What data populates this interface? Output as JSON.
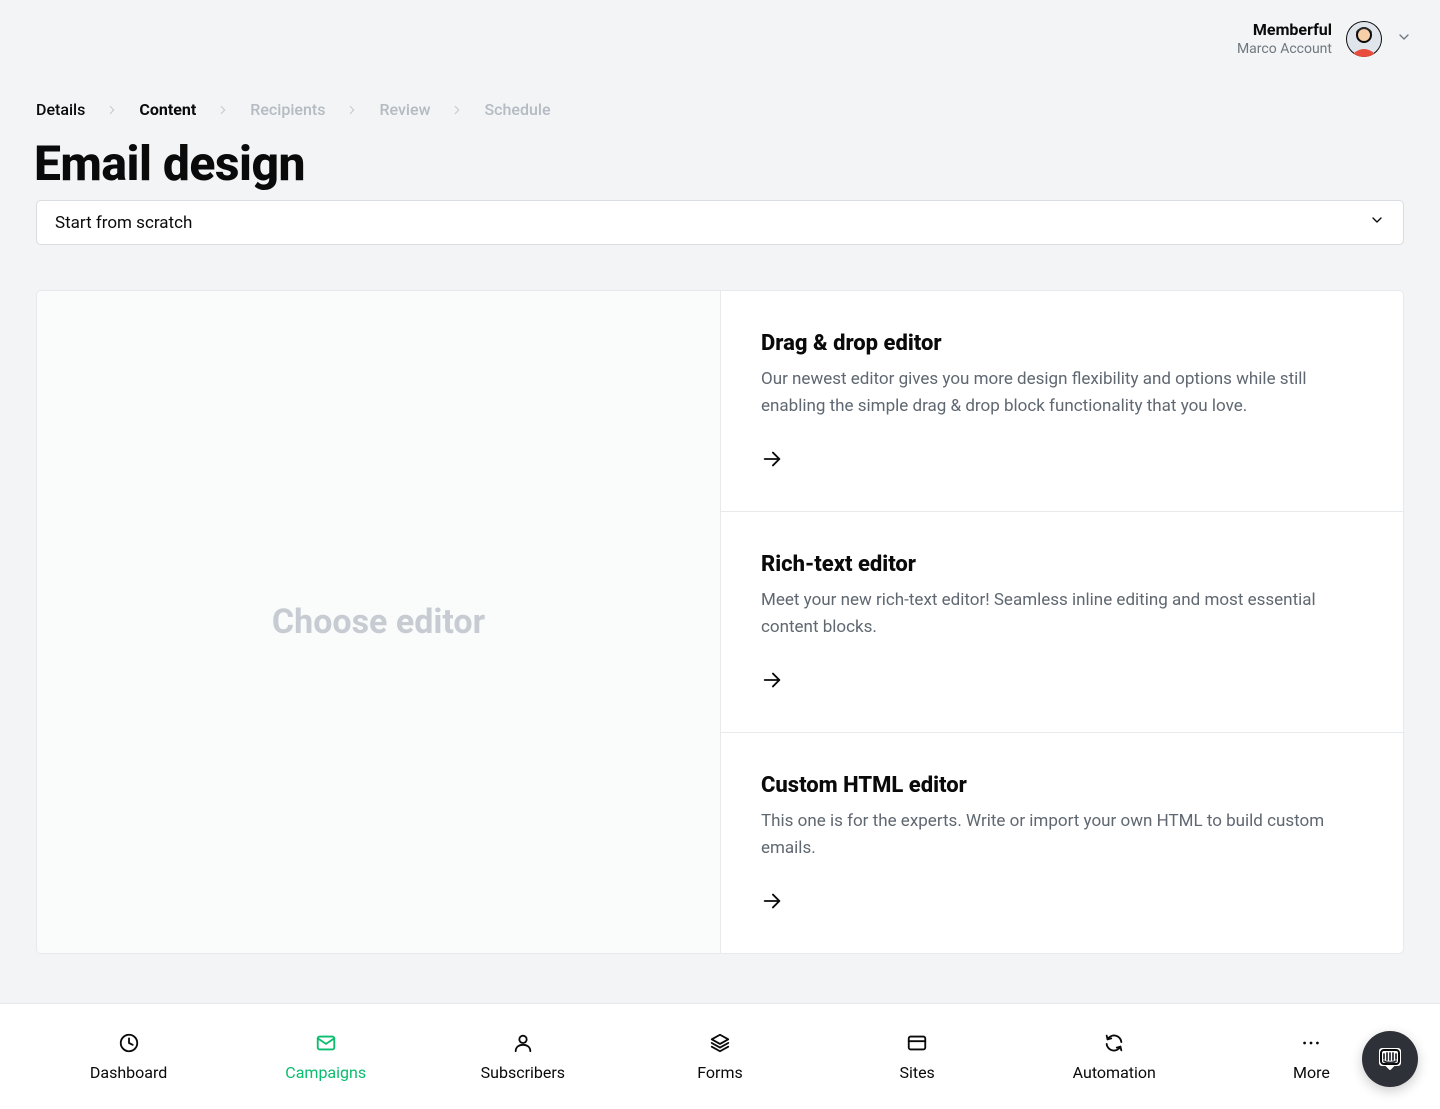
{
  "header": {
    "account_name": "Memberful",
    "account_sub": "Marco Account"
  },
  "breadcrumb": {
    "items": [
      {
        "label": "Details",
        "state": "done"
      },
      {
        "label": "Content",
        "state": "active"
      },
      {
        "label": "Recipients",
        "state": "disabled"
      },
      {
        "label": "Review",
        "state": "disabled"
      },
      {
        "label": "Schedule",
        "state": "disabled"
      }
    ]
  },
  "page": {
    "title": "Email design"
  },
  "template_select": {
    "value": "Start from scratch"
  },
  "preview": {
    "placeholder": "Choose editor"
  },
  "editors": [
    {
      "title": "Drag & drop editor",
      "desc": "Our newest editor gives you more design flexibility and options while still enabling the simple drag & drop block functionality that you love."
    },
    {
      "title": "Rich-text editor",
      "desc": "Meet your new rich-text editor! Seamless inline editing and most essential content blocks."
    },
    {
      "title": "Custom HTML editor",
      "desc": "This one is for the experts. Write or import your own HTML to build custom emails."
    }
  ],
  "nav": {
    "items": [
      {
        "label": "Dashboard",
        "icon": "clock-icon",
        "active": false
      },
      {
        "label": "Campaigns",
        "icon": "mail-icon",
        "active": true
      },
      {
        "label": "Subscribers",
        "icon": "person-icon",
        "active": false
      },
      {
        "label": "Forms",
        "icon": "layers-icon",
        "active": false
      },
      {
        "label": "Sites",
        "icon": "website-icon",
        "active": false
      },
      {
        "label": "Automation",
        "icon": "sync-icon",
        "active": false
      },
      {
        "label": "More",
        "icon": "dots-icon",
        "active": false
      }
    ]
  }
}
